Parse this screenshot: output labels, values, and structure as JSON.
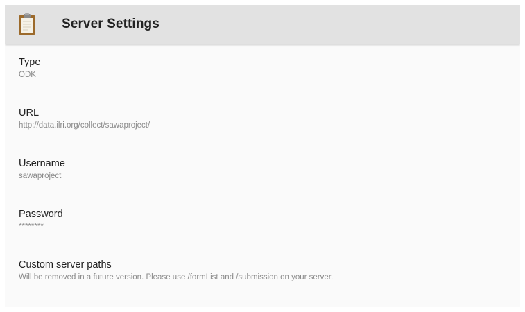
{
  "header": {
    "icon": "clipboard-icon",
    "title": "Server Settings"
  },
  "preferences": [
    {
      "title": "Type",
      "summary": "ODK"
    },
    {
      "title": "URL",
      "summary": "http://data.ilri.org/collect/sawaproject/"
    },
    {
      "title": "Username",
      "summary": "sawaproject"
    },
    {
      "title": "Password",
      "summary": "********"
    },
    {
      "title": "Custom server paths",
      "summary": "Will be removed in a future version. Please use /formList and /submission on your server."
    }
  ],
  "colors": {
    "app_bar": "#e2e2e2",
    "background": "#fafafa",
    "clipboard_board": "#9c6a2b",
    "clipboard_clip": "#8a8a8a",
    "summary_text": "#8a8a8a"
  }
}
